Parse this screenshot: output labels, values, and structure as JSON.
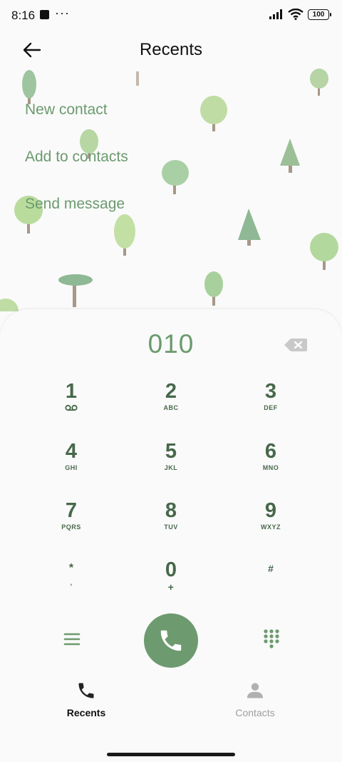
{
  "status": {
    "time": "8:16",
    "dots": "···",
    "battery": "100"
  },
  "header": {
    "title": "Recents"
  },
  "menu": {
    "new_contact": "New contact",
    "add_to_contacts": "Add to contacts",
    "send_message": "Send message"
  },
  "dialer": {
    "number": "010",
    "keys": [
      {
        "digit": "1",
        "letters": ""
      },
      {
        "digit": "2",
        "letters": "ABC"
      },
      {
        "digit": "3",
        "letters": "DEF"
      },
      {
        "digit": "4",
        "letters": "GHI"
      },
      {
        "digit": "5",
        "letters": "JKL"
      },
      {
        "digit": "6",
        "letters": "MNO"
      },
      {
        "digit": "7",
        "letters": "PQRS"
      },
      {
        "digit": "8",
        "letters": "TUV"
      },
      {
        "digit": "9",
        "letters": "WXYZ"
      },
      {
        "digit": "*",
        "letters": ","
      },
      {
        "digit": "0",
        "letters": "+"
      },
      {
        "digit": "#",
        "letters": ""
      }
    ]
  },
  "tabs": {
    "recents": "Recents",
    "contacts": "Contacts"
  },
  "colors": {
    "accent": "#6d9a6f",
    "key_text": "#47684a",
    "inactive": "#aaaaaa"
  }
}
